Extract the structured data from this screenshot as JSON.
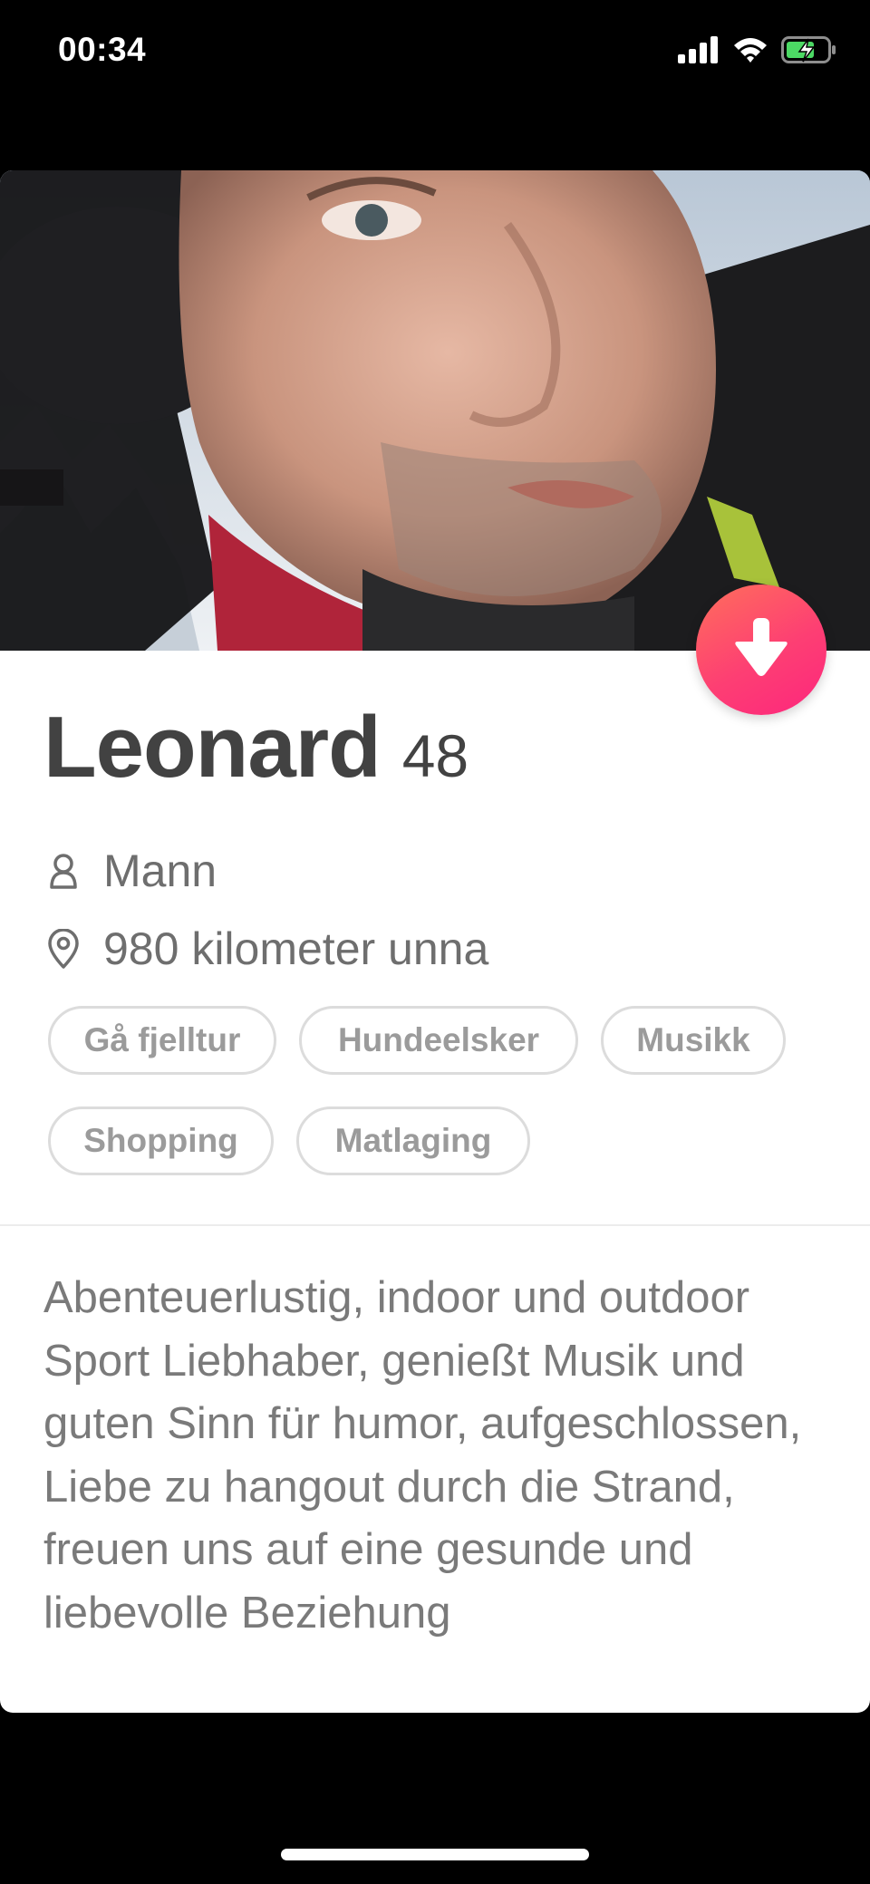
{
  "status_bar": {
    "time": "00:34",
    "icons": [
      "signal-icon",
      "wifi-icon",
      "battery-charging-icon"
    ],
    "battery_color": "#4cd964"
  },
  "profile": {
    "photo": "profile-photo",
    "name": "Leonard",
    "age": "48",
    "gender": "Mann",
    "gender_icon": "person-icon",
    "distance": "980 kilometer unna",
    "distance_icon": "location-pin-icon",
    "interests": [
      "Gå fjelltur",
      "Hundeelsker",
      "Musikk",
      "Shopping",
      "Matlaging"
    ],
    "bio": "Abenteuerlustig, indoor und outdoor Sport Liebhaber, genießt Musik und guten Sinn für humor, aufgeschlossen, Liebe zu hangout durch die Strand, freuen uns auf eine gesunde und liebevolle Beziehung"
  },
  "actions": {
    "collapse_icon": "arrow-down-icon",
    "accent_gradient": [
      "#ff6f5b",
      "#fd267d"
    ]
  }
}
